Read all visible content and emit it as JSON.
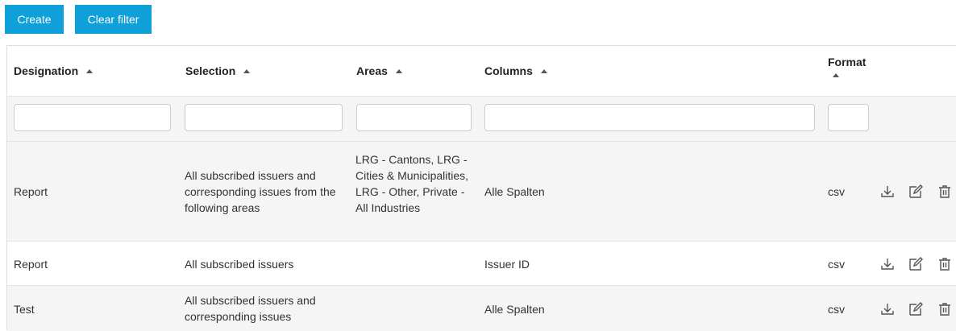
{
  "toolbar": {
    "create_label": "Create",
    "clear_filter_label": "Clear filter"
  },
  "columns": {
    "designation": "Designation",
    "selection": "Selection",
    "areas": "Areas",
    "columns": "Columns",
    "format": "Format"
  },
  "filters": {
    "designation": "",
    "selection": "",
    "areas": "",
    "columns": "",
    "format": ""
  },
  "rows": [
    {
      "designation": "Report",
      "selection": "All subscribed issuers and corresponding issues from the following areas",
      "areas": "LRG - Cantons, LRG - Cities & Municipalities, LRG - Other, Private - All Industries",
      "columns": "Alle Spalten",
      "format": "csv"
    },
    {
      "designation": "Report",
      "selection": "All subscribed issuers",
      "areas": "",
      "columns": "Issuer ID",
      "format": "csv"
    },
    {
      "designation": "Test",
      "selection": "All subscribed issuers and corresponding issues",
      "areas": "",
      "columns": "Alle Spalten",
      "format": "csv"
    }
  ],
  "row_actions": [
    "download-icon",
    "edit-icon",
    "trash-icon"
  ],
  "colors": {
    "accent": "#0f9fd9",
    "stripe": "#f5f5f5",
    "border": "#dddddd"
  }
}
